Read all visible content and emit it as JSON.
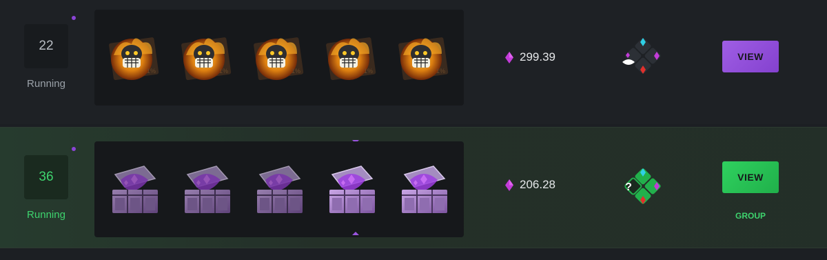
{
  "colors": {
    "purple_accent": "#9a55e0",
    "green_accent": "#3ed46e",
    "view_purple": "#9f5ee4",
    "view_green": "#2fd15f"
  },
  "rows": [
    {
      "round": "22",
      "status": "Running",
      "case_icon": "flaming-skull-case-icon",
      "case_count": 5,
      "price": "299.39",
      "button_label": "VIEW"
    },
    {
      "round": "36",
      "status": "Running",
      "case_icon": "purple-crate-case-icon",
      "case_count": 5,
      "price": "206.28",
      "button_label": "VIEW",
      "group_label": "GROUP"
    }
  ]
}
